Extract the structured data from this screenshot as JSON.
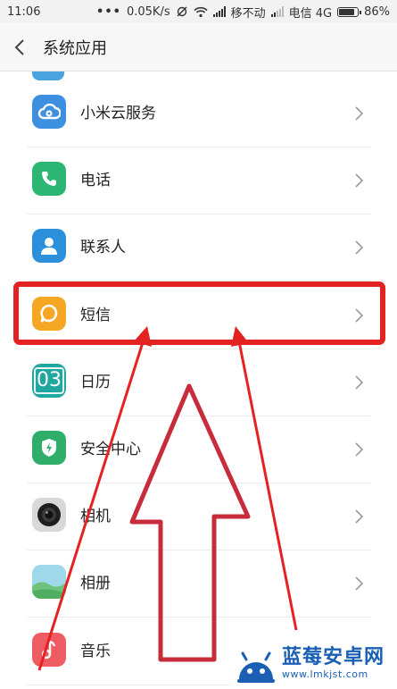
{
  "status_bar": {
    "time": "11:06",
    "dots": "•••",
    "speed": "0.05K/s",
    "carrier1": "移不动",
    "carrier2": "电信 4G",
    "battery_text": "86%",
    "battery_level": 0.86
  },
  "header": {
    "title": "系统应用"
  },
  "items": [
    {
      "label": "小米云服务",
      "icon": "cloud-icon",
      "color": "#3d8fe0"
    },
    {
      "label": "电话",
      "icon": "phone-icon",
      "color": "#2bb673"
    },
    {
      "label": "联系人",
      "icon": "contacts-icon",
      "color": "#2b8fd9"
    },
    {
      "label": "短信",
      "icon": "message-icon",
      "color": "#f5a623"
    },
    {
      "label": "日历",
      "icon": "calendar-icon",
      "color": "#1fa7a0",
      "icon_text": "03"
    },
    {
      "label": "安全中心",
      "icon": "shield-icon",
      "color": "#2fae6a"
    },
    {
      "label": "相机",
      "icon": "camera-icon",
      "color": "#d8d8d8"
    },
    {
      "label": "相册",
      "icon": "gallery-icon",
      "color": "#8fd0a8"
    },
    {
      "label": "音乐",
      "icon": "music-icon",
      "color": "#ef5b62"
    }
  ],
  "watermark": {
    "name": "蓝莓安卓网",
    "url": "www.lmkjst.com"
  },
  "colors": {
    "annotation_red": "#e52222",
    "text": "#222222",
    "chevron": "#9a9a9a"
  }
}
